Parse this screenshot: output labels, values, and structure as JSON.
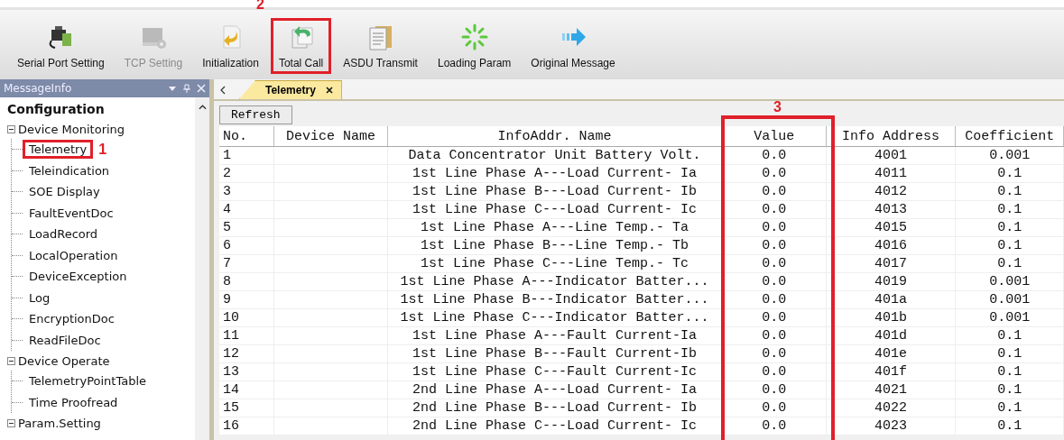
{
  "toolbar": {
    "buttons": [
      {
        "label": "Serial Port Setting",
        "disabled": false
      },
      {
        "label": "TCP Setting",
        "disabled": true
      },
      {
        "label": "Initialization",
        "disabled": false
      },
      {
        "label": "Total Call",
        "disabled": false,
        "callout": "2"
      },
      {
        "label": "ASDU Transmit",
        "disabled": false
      },
      {
        "label": "Loading Param",
        "disabled": false
      },
      {
        "label": "Original Message",
        "disabled": false
      }
    ]
  },
  "sidebar": {
    "title": "MessageInfo",
    "heading": "Configuration",
    "items": [
      {
        "label": "Device Monitoring",
        "expanded": true,
        "children": [
          {
            "label": "Telemetry",
            "callout": "1"
          },
          {
            "label": "Teleindication"
          },
          {
            "label": "SOE Display"
          },
          {
            "label": "FaultEventDoc"
          },
          {
            "label": "LoadRecord"
          },
          {
            "label": "LocalOperation"
          },
          {
            "label": "DeviceException"
          },
          {
            "label": "Log"
          },
          {
            "label": "EncryptionDoc"
          },
          {
            "label": "ReadFileDoc"
          }
        ]
      },
      {
        "label": "Device Operate",
        "expanded": true,
        "children": [
          {
            "label": "TelemetryPointTable"
          },
          {
            "label": "Time Proofread"
          }
        ]
      },
      {
        "label": "Param.Setting",
        "expanded": true
      }
    ]
  },
  "tabs": [
    {
      "label": "Telemetry",
      "selected": true
    }
  ],
  "refresh_button": "Refresh",
  "table": {
    "columns": [
      {
        "label": "No."
      },
      {
        "label": "Device Name"
      },
      {
        "label": "InfoAddr. Name"
      },
      {
        "label": "Value",
        "callout": "3"
      },
      {
        "label": "Info Address"
      },
      {
        "label": "Coefficient"
      }
    ],
    "rows": [
      [
        "1",
        "",
        "Data Concentrator Unit Battery Volt.",
        "0.0",
        "4001",
        "0.001"
      ],
      [
        "2",
        "",
        "1st Line Phase A---Load Current- Ia",
        "0.0",
        "4011",
        "0.1"
      ],
      [
        "3",
        "",
        "1st Line Phase B---Load Current- Ib",
        "0.0",
        "4012",
        "0.1"
      ],
      [
        "4",
        "",
        "1st Line Phase C---Load Current- Ic",
        "0.0",
        "4013",
        "0.1"
      ],
      [
        "5",
        "",
        "1st Line Phase A---Line Temp.- Ta",
        "0.0",
        "4015",
        "0.1"
      ],
      [
        "6",
        "",
        "1st Line Phase B---Line Temp.- Tb",
        "0.0",
        "4016",
        "0.1"
      ],
      [
        "7",
        "",
        "1st Line Phase C---Line Temp.- Tc",
        "0.0",
        "4017",
        "0.1"
      ],
      [
        "8",
        "",
        "1st Line Phase A---Indicator Batter...",
        "0.0",
        "4019",
        "0.001"
      ],
      [
        "9",
        "",
        "1st Line Phase B---Indicator Batter...",
        "0.0",
        "401a",
        "0.001"
      ],
      [
        "10",
        "",
        "1st Line Phase C---Indicator Batter...",
        "0.0",
        "401b",
        "0.001"
      ],
      [
        "11",
        "",
        "1st Line Phase A---Fault Current-Ia",
        "0.0",
        "401d",
        "0.1"
      ],
      [
        "12",
        "",
        "1st Line Phase B---Fault Current-Ib",
        "0.0",
        "401e",
        "0.1"
      ],
      [
        "13",
        "",
        "1st Line Phase C---Fault Current-Ic",
        "0.0",
        "401f",
        "0.1"
      ],
      [
        "14",
        "",
        "2nd Line Phase A---Load Current- Ia",
        "0.0",
        "4021",
        "0.1"
      ],
      [
        "15",
        "",
        "2nd Line Phase B---Load Current- Ib",
        "0.0",
        "4022",
        "0.1"
      ],
      [
        "16",
        "",
        "2nd Line Phase C---Load Current- Ic",
        "0.0",
        "4023",
        "0.1"
      ]
    ]
  }
}
